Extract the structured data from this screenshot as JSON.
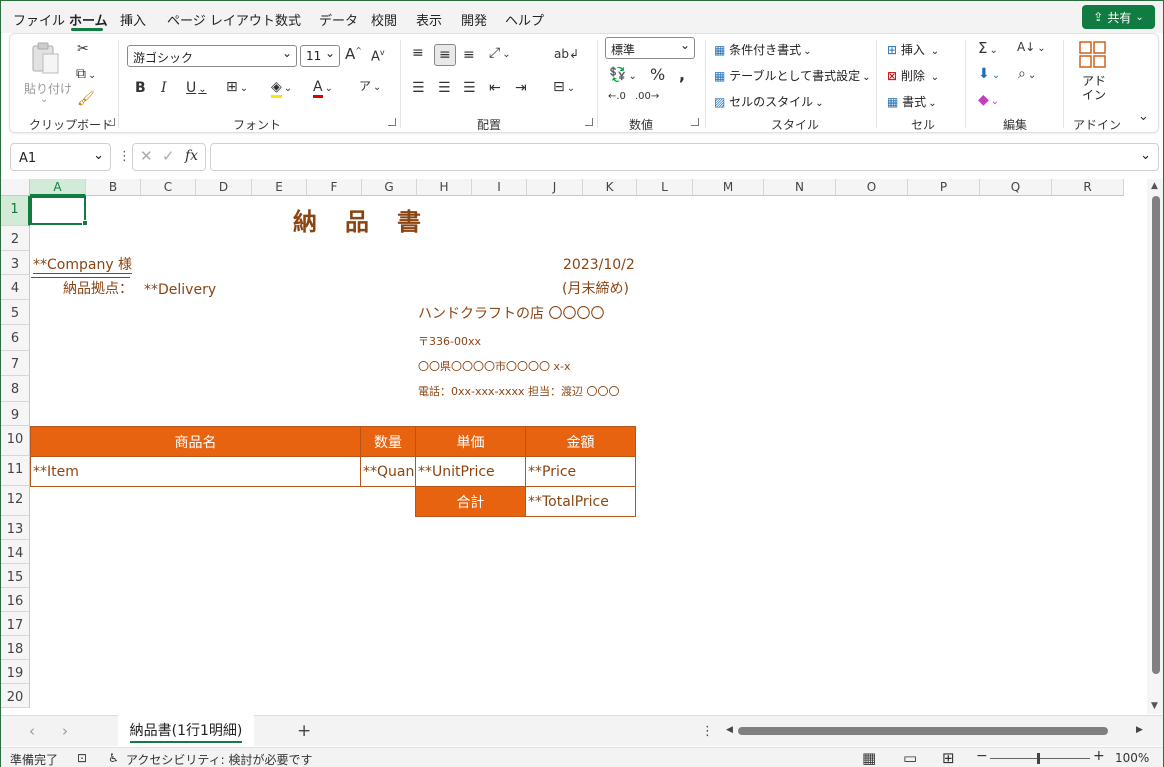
{
  "menu": {
    "tabs": [
      "ファイル",
      "ホーム",
      "挿入",
      "ページ レイアウト",
      "数式",
      "データ",
      "校閲",
      "表示",
      "開発",
      "ヘルプ"
    ],
    "share": "共有"
  },
  "ribbon": {
    "clipboard": {
      "paste": "貼り付け",
      "label": "クリップボード"
    },
    "font": {
      "name": "游ゴシック",
      "size": "11",
      "label": "フォント"
    },
    "alignment": {
      "label": "配置"
    },
    "number": {
      "format": "標準",
      "label": "数値"
    },
    "styles": {
      "conditional": "条件付き書式",
      "table": "テーブルとして書式設定",
      "cell_styles": "セルのスタイル",
      "label": "スタイル"
    },
    "cells": {
      "insert": "挿入",
      "delete": "削除",
      "format": "書式",
      "label": "セル"
    },
    "editing": {
      "label": "編集"
    },
    "addins": {
      "button": "アド\nイン",
      "label": "アドイン"
    }
  },
  "formula_bar": {
    "name_box": "A1",
    "fx": "fx"
  },
  "columns": [
    "A",
    "B",
    "C",
    "D",
    "E",
    "F",
    "G",
    "H",
    "I",
    "J",
    "K",
    "L",
    "M",
    "N",
    "O",
    "P",
    "Q",
    "R"
  ],
  "rows": [
    "1",
    "2",
    "3",
    "4",
    "5",
    "6",
    "7",
    "8",
    "9",
    "10",
    "11",
    "12",
    "13",
    "14",
    "15",
    "16",
    "17",
    "18",
    "19",
    "20"
  ],
  "sheet": {
    "title": "納　品　書",
    "company": "**Company 様",
    "date": "2023/10/2",
    "delivery_label": "納品拠点：",
    "delivery_value": "**Delivery",
    "closing": "(月末締め)",
    "shop": "ハンドクラフトの店 〇〇〇〇",
    "zip": "〒336-00xx",
    "address": "〇〇県〇〇〇〇市〇〇〇〇 x-x",
    "phone": "電話：0xx-xxx-xxxx 担当：渡辺 〇〇〇",
    "table": {
      "headers": [
        "商品名",
        "数量",
        "単価",
        "金額"
      ],
      "row": [
        "**Item",
        "**Quan",
        "**UnitPrice",
        "**Price"
      ],
      "total_label": "合計",
      "total_value": "**TotalPrice"
    }
  },
  "sheet_tab": "納品書(1行1明細)",
  "status": {
    "ready": "準備完了",
    "accessibility": "アクセシビリティ: 検討が必要です",
    "zoom": "100%"
  }
}
